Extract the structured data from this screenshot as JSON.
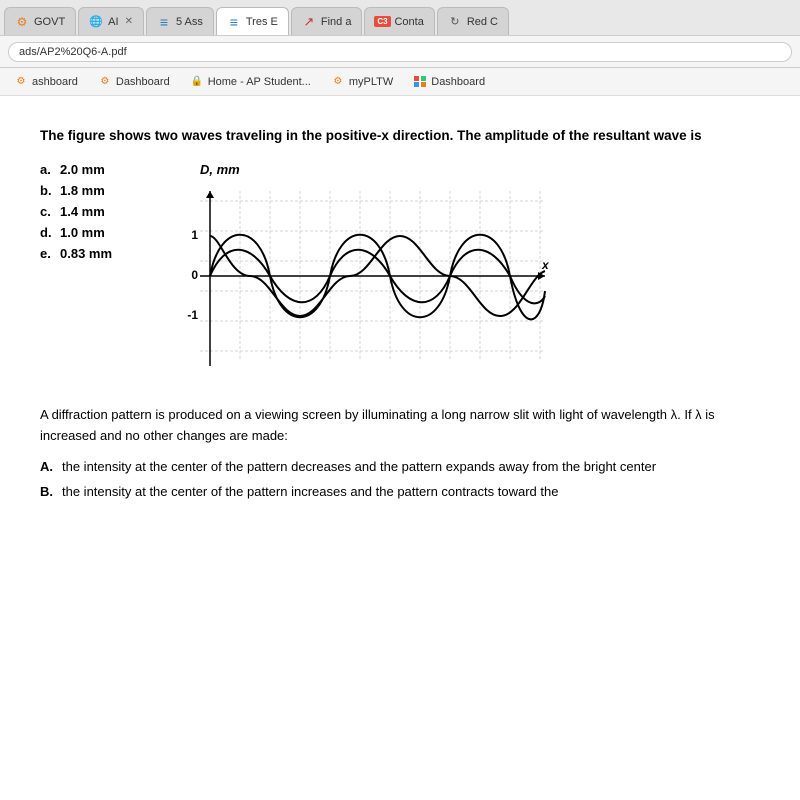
{
  "browser": {
    "tabs": [
      {
        "id": "govt",
        "icon": "⚙",
        "label": "GOVT",
        "closable": false,
        "active": false,
        "iconColor": "#e67e22"
      },
      {
        "id": "ai",
        "icon": "🌐",
        "label": "AI",
        "closable": true,
        "active": false
      },
      {
        "id": "5ass",
        "icon": "≡",
        "label": "5 Ass",
        "closable": false,
        "active": false,
        "iconColor": "#2980b9"
      },
      {
        "id": "tres",
        "icon": "≡",
        "label": "Tres E",
        "closable": false,
        "active": true,
        "iconColor": "#2980b9"
      },
      {
        "id": "find",
        "icon": "↗",
        "label": "Find a",
        "closable": false,
        "active": false,
        "iconColor": "#c0392b"
      },
      {
        "id": "conta",
        "icon": "C3",
        "label": "Conta",
        "closable": false,
        "active": false
      },
      {
        "id": "red",
        "icon": "↻",
        "label": "Red C",
        "closable": false,
        "active": false
      }
    ],
    "address": "ads/AP2%20Q6-A.pdf",
    "bookmarks": [
      {
        "label": "ashboard",
        "icon": "⚙"
      },
      {
        "label": "Dashboard",
        "icon": "⚙"
      },
      {
        "label": "Home - AP Student...",
        "icon": "🔒"
      },
      {
        "label": "myPLTW",
        "icon": "⚙"
      },
      {
        "label": "Dashboard",
        "icon": "📊"
      }
    ]
  },
  "page": {
    "question1": {
      "text": "The figure shows two waves traveling in the positive-x direction. The amplitude\nof the resultant wave is",
      "graph_label": "D, mm",
      "x_label": "x",
      "y_labels": [
        "1",
        "0",
        "-1"
      ],
      "choices": [
        {
          "letter": "a.",
          "value": "2.0 mm"
        },
        {
          "letter": "b.",
          "value": "1.8 mm"
        },
        {
          "letter": "c.",
          "value": "1.4 mm"
        },
        {
          "letter": "d.",
          "value": "1.0 mm"
        },
        {
          "letter": "e.",
          "value": "0.83 mm"
        }
      ]
    },
    "question2": {
      "intro": "A diffraction pattern is produced on a viewing screen by illuminating a long narrow slit with light of wavelength λ. If λ is increased and no other changes are made:",
      "answers": [
        {
          "letter": "A.",
          "text": "the intensity at the center of the pattern decreases and the pattern expands away from the bright center"
        },
        {
          "letter": "B.",
          "text": "the intensity at the center of the pattern increases and the pattern contracts toward the"
        }
      ]
    }
  }
}
